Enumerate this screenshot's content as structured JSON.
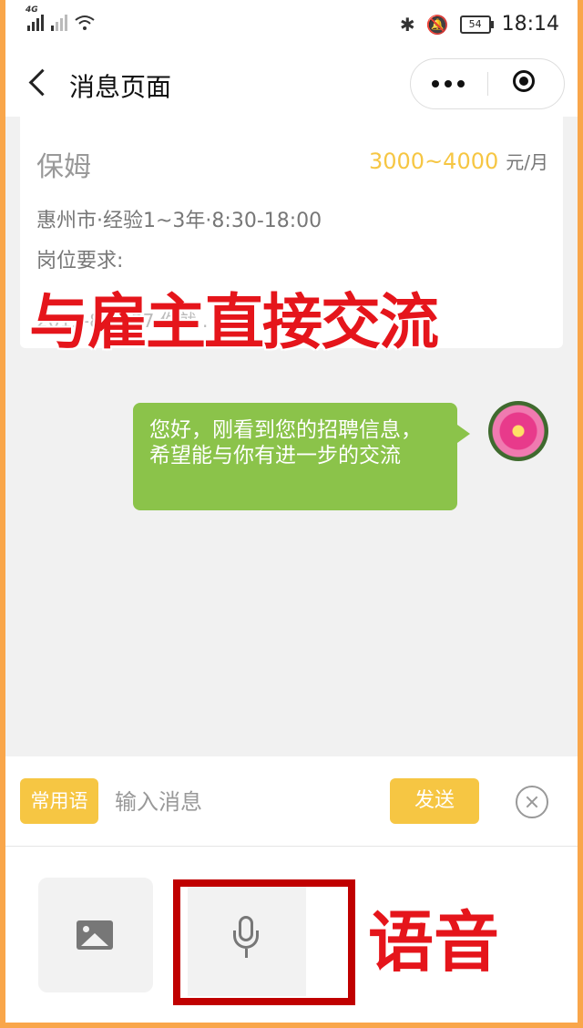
{
  "status_bar": {
    "network_type": "4G",
    "time": "18:14",
    "battery": "54",
    "icons": [
      "signal-icon",
      "signal-icon",
      "wifi-icon",
      "bluetooth-icon",
      "bell-off-icon",
      "battery-icon"
    ]
  },
  "navbar": {
    "title": "消息页面",
    "icons": [
      "back-icon",
      "more-icon",
      "close-miniprogram-icon"
    ]
  },
  "job": {
    "title": "保姆",
    "salary": "3000~4000",
    "salary_unit": "元/月",
    "meta": "惠州市·经验1~3年·8:30-18:00",
    "requirement_label": "岗位要求:",
    "footer": "2019-8-      4:37 你就 .  不  求 "
  },
  "overlay": {
    "headline": "与雇主直接交流",
    "voice_caption": "语音"
  },
  "message": {
    "text": "您好，刚看到您的招聘信息，希望能与你有进一步的交流"
  },
  "input_bar": {
    "phrases_label": "常用语",
    "placeholder": "输入消息",
    "send_label": "发送"
  },
  "toolbar": {
    "icons": [
      "image-icon",
      "microphone-icon"
    ]
  },
  "colors": {
    "accent_yellow": "#f6c643",
    "bubble_green": "#8bc34a",
    "overlay_red": "#e5151b",
    "frame_orange": "#f9a64a"
  }
}
